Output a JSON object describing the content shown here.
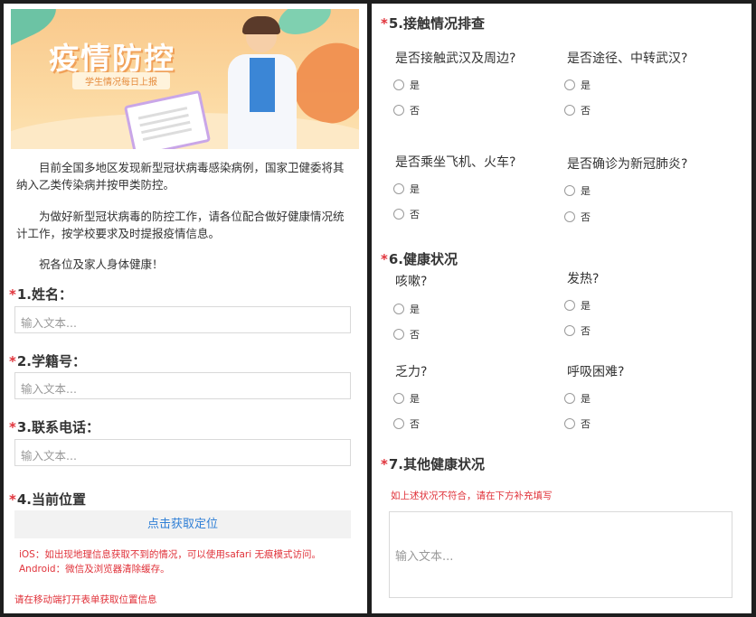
{
  "banner": {
    "title": "疫情防控",
    "subtitle": "学生情况每日上报"
  },
  "intro": {
    "p1": "目前全国多地区发现新型冠状病毒感染病例，国家卫健委将其纳入乙类传染病并按甲类防控。",
    "p2": "为做好新型冠状病毒的防控工作，请各位配合做好健康情况统计工作，按学校要求及时提报疫情信息。",
    "p3": "祝各位及家人身体健康！"
  },
  "q1": {
    "star": "*",
    "label": "1.姓名：",
    "placeholder": "输入文本..."
  },
  "q2": {
    "star": "*",
    "label": "2.学籍号：",
    "placeholder": "输入文本..."
  },
  "q3": {
    "star": "*",
    "label": "3.联系电话：",
    "placeholder": "输入文本..."
  },
  "q4": {
    "star": "*",
    "label": "4.当前位置",
    "button": "点击获取定位",
    "tip1": "iOS：如出现地理信息获取不到的情况，可以使用safari 无痕模式访问。",
    "tip2": "Android：微信及浏览器清除缓存。",
    "warning": "请在移动端打开表单获取位置信息"
  },
  "q5": {
    "star": "*",
    "label": "5.接触情况排查",
    "items": [
      {
        "question": "是否接触武汉及周边?",
        "yes": "是",
        "no": "否"
      },
      {
        "question": "是否途径、中转武汉?",
        "yes": "是",
        "no": "否"
      },
      {
        "question": "是否乘坐飞机、火车?",
        "yes": "是",
        "no": "否"
      },
      {
        "question": "是否确诊为新冠肺炎?",
        "yes": "是",
        "no": "否"
      }
    ]
  },
  "q6": {
    "star": "*",
    "label": "6.健康状况",
    "items": [
      {
        "question": "咳嗽?",
        "yes": "是",
        "no": "否"
      },
      {
        "question": "发热?",
        "yes": "是",
        "no": "否"
      },
      {
        "question": "乏力?",
        "yes": "是",
        "no": "否"
      },
      {
        "question": "呼吸困难?",
        "yes": "是",
        "no": "否"
      }
    ]
  },
  "q7": {
    "star": "*",
    "label": "7.其他健康状况",
    "hint": "如上述状况不符合，请在下方补充填写",
    "placeholder": "输入文本..."
  }
}
